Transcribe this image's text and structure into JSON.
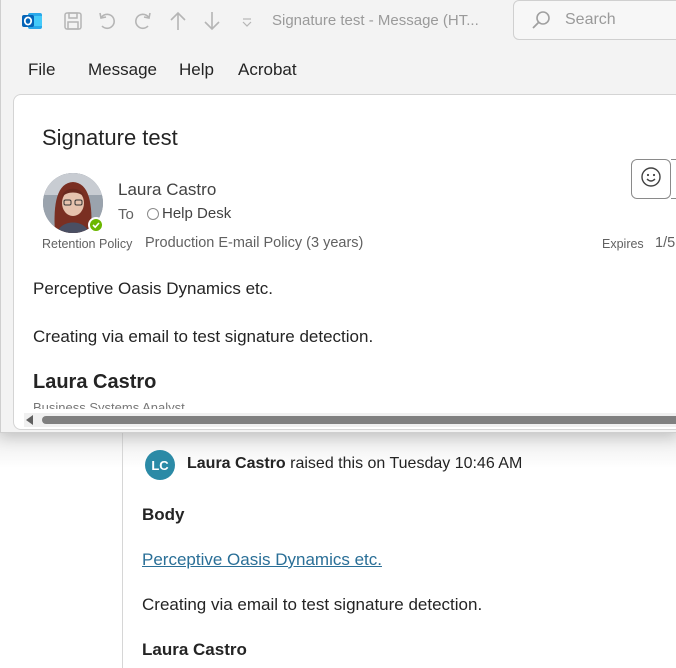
{
  "window": {
    "title": "Signature test  -  Message (HT...",
    "search_placeholder": "Search"
  },
  "menu": [
    "File",
    "Message",
    "Help",
    "Acrobat"
  ],
  "message": {
    "subject": "Signature test",
    "sender": "Laura Castro",
    "to_label": "To",
    "recipient": "Help Desk",
    "retention_label": "Retention Policy",
    "retention_value": "Production E-mail Policy (3 years)",
    "expires_label": "Expires",
    "expires_value": "1/5",
    "body_line1": "Perceptive Oasis Dynamics etc.",
    "body_line2": "Creating via email to test signature detection.",
    "signature_name": "Laura Castro",
    "signature_title": "Business Systems Analyst"
  },
  "comment": {
    "avatar_initials": "LC",
    "author": "Laura Castro",
    "action": " raised this on Tuesday 10:46 AM",
    "body_label": "Body",
    "link_text": "Perceptive Oasis Dynamics etc.",
    "line2": "Creating via email to test signature detection.",
    "name": "Laura Castro"
  },
  "colors": {
    "presence": "#6bb700",
    "avatar_bg": "#2b8aa6",
    "link": "#2a6f97"
  }
}
